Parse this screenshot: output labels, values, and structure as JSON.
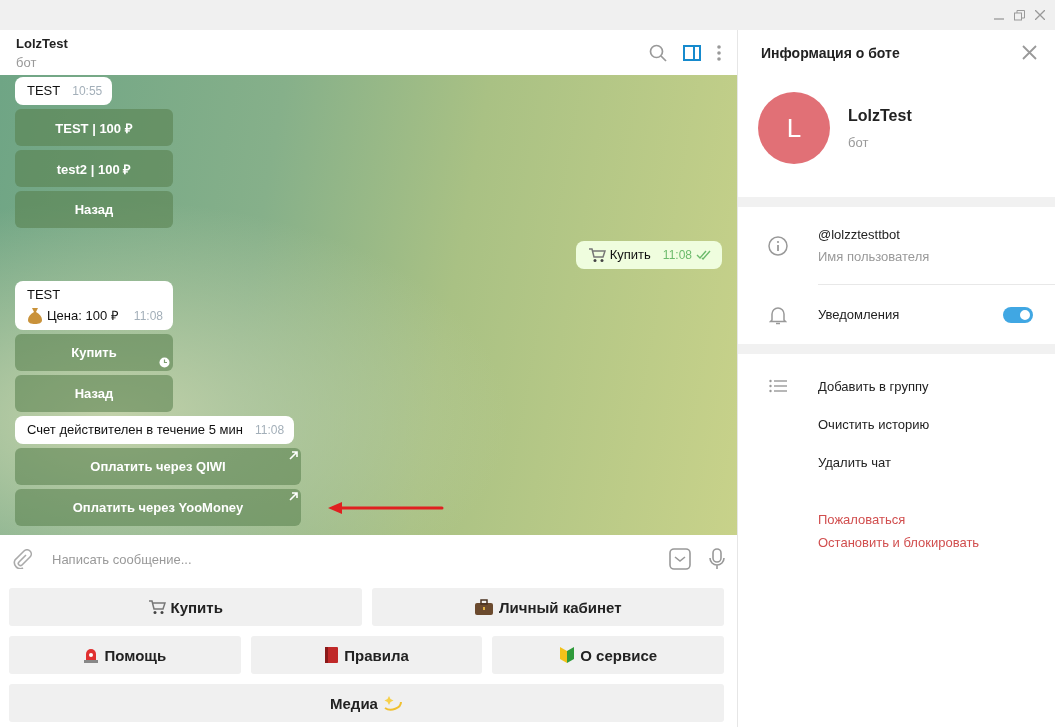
{
  "chat_header": {
    "title": "LolzTest",
    "subtitle": "бот",
    "sidebar_toggle_on": true
  },
  "messages": [
    {
      "kind": "incoming",
      "lines": [
        "TEST"
      ],
      "time": "10:55"
    },
    {
      "kind": "keyboard",
      "buttons": [
        {
          "label": "TEST | 100 ₽",
          "pending": false,
          "link": false
        },
        {
          "label": "test2 | 100 ₽",
          "pending": false,
          "link": false
        },
        {
          "label": "Назад",
          "pending": false,
          "link": false
        }
      ]
    },
    {
      "kind": "outgoing",
      "lines": [
        "Купить"
      ],
      "time": "11:08",
      "read": true
    },
    {
      "kind": "incoming",
      "lines": [
        "TEST",
        "Цена: 100 ₽"
      ],
      "time": "11:08"
    },
    {
      "kind": "keyboard",
      "buttons": [
        {
          "label": "Купить",
          "pending": true,
          "link": false
        },
        {
          "label": "Назад",
          "pending": false,
          "link": false
        }
      ]
    },
    {
      "kind": "incoming",
      "lines": [
        "Счет действителен в течение 5 мин"
      ],
      "time": "11:08"
    },
    {
      "kind": "keyboard",
      "buttons": [
        {
          "label": "Оплатить через QIWI",
          "pending": false,
          "link": true,
          "marked": false
        },
        {
          "label": "Оплатить через YooMoney",
          "pending": false,
          "link": true,
          "marked": true
        }
      ]
    }
  ],
  "composer": {
    "placeholder": "Написать сообщение..."
  },
  "reply_keyboard": [
    [
      {
        "label": "Купить"
      },
      {
        "label": "Личный кабинет"
      }
    ],
    [
      {
        "label": "Помощь"
      },
      {
        "label": "Правила"
      },
      {
        "label": "О сервисе"
      }
    ],
    [
      {
        "label": "Медиа"
      }
    ]
  ],
  "info_panel": {
    "title": "Информация о боте",
    "avatar_letter": "L",
    "name": "LolzTest",
    "status": "бот",
    "username": {
      "value": "@lolzztesttbot",
      "label": "Имя пользователя"
    },
    "notifications": {
      "label": "Уведомления",
      "on": true
    },
    "actions": [
      {
        "label": "Добавить в группу",
        "danger": false
      },
      {
        "label": "Очистить историю",
        "danger": false
      },
      {
        "label": "Удалить чат",
        "danger": false
      },
      {
        "label": "Пожаловаться",
        "danger": true
      },
      {
        "label": "Остановить и блокировать",
        "danger": true
      }
    ]
  }
}
